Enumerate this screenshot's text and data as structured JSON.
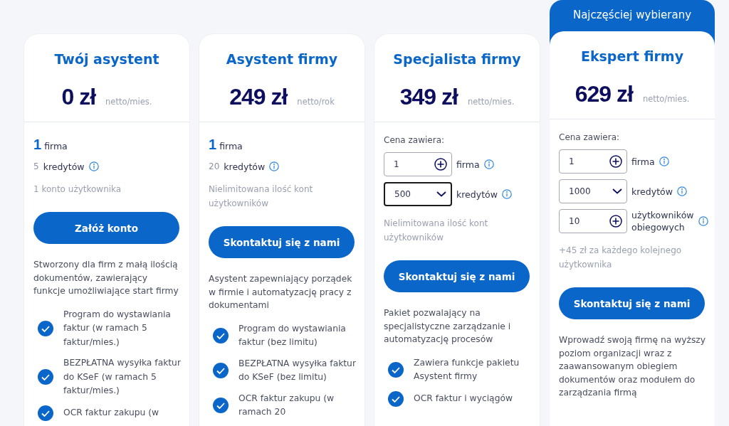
{
  "plans": [
    {
      "title": "Twój asystent",
      "price": "0 zł",
      "period": "netto/mies.",
      "popular": false,
      "rows": [
        {
          "kind": "count",
          "value": "1",
          "label": "firma"
        },
        {
          "kind": "credits",
          "value": "5",
          "label": "kredytów"
        },
        {
          "kind": "note",
          "text": "1 konto użytkownika"
        }
      ],
      "button": "Załóż konto",
      "description": "Stworzony dla firm z małą ilością dokumentów, zawierający funkcje umożliwiające start firmy",
      "features": [
        "Program do wystawiania faktur (w ramach 5 faktur/mies.)",
        "BEZPŁATNA wysyłka faktur do KSeF (w ramach 5 faktur/mies.)",
        "OCR faktur zakupu (w"
      ]
    },
    {
      "title": "Asystent firmy",
      "price": "249 zł",
      "period": "netto/rok",
      "popular": false,
      "rows": [
        {
          "kind": "count",
          "value": "1",
          "label": "firma"
        },
        {
          "kind": "credits",
          "value": "20",
          "label": "kredytów"
        },
        {
          "kind": "note",
          "text": "Nielimitowana ilość kont użytkowników"
        }
      ],
      "button": "Skontaktuj się z nami",
      "description": "Asystent zapewniający porządek w firmie i automatyzację pracy z dokumentami",
      "features": [
        "Program do wystawiania faktur (bez limitu)",
        "BEZPŁATNA wysyłka faktur do KSeF (bez limitu)",
        "OCR faktur zakupu (w ramach 20"
      ]
    },
    {
      "title": "Specjalista firmy",
      "price": "349 zł",
      "period": "netto/mies.",
      "popular": false,
      "rows": [
        {
          "kind": "heading",
          "text": "Cena zawiera:"
        },
        {
          "kind": "stepper",
          "value": "1",
          "label": "firma"
        },
        {
          "kind": "select",
          "value": "500",
          "label": "kredytów",
          "focused": true
        },
        {
          "kind": "note",
          "text": "Nielimitowana ilość kont użytkowników"
        }
      ],
      "button": "Skontaktuj się z nami",
      "description": "Pakiet pozwalający na specjalistyczne zarządzanie i automatyzację procesów",
      "features": [
        "Zawiera funkcje pakietu Asystent firmy",
        "OCR faktur i wyciągów"
      ]
    },
    {
      "title": "Ekspert firmy",
      "price": "629 zł",
      "period": "netto/mies.",
      "popular": true,
      "badge": "Najczęściej wybierany",
      "rows": [
        {
          "kind": "heading",
          "text": "Cena zawiera:"
        },
        {
          "kind": "stepper",
          "value": "1",
          "label": "firma"
        },
        {
          "kind": "select",
          "value": "1000",
          "label": "kredytów",
          "focused": false
        },
        {
          "kind": "stepper",
          "value": "10",
          "label": "użytkowników obiegowych"
        },
        {
          "kind": "note",
          "text": "+45 zł za każdego kolejnego użytkownika"
        }
      ],
      "button": "Skontaktuj się z nami",
      "description": "Wprowadź swoją firmę na wyższy poziom organizacji wraz z zaawansowanym obiegiem dokumentów oraz modułem do zarządzania firmą"
    }
  ]
}
